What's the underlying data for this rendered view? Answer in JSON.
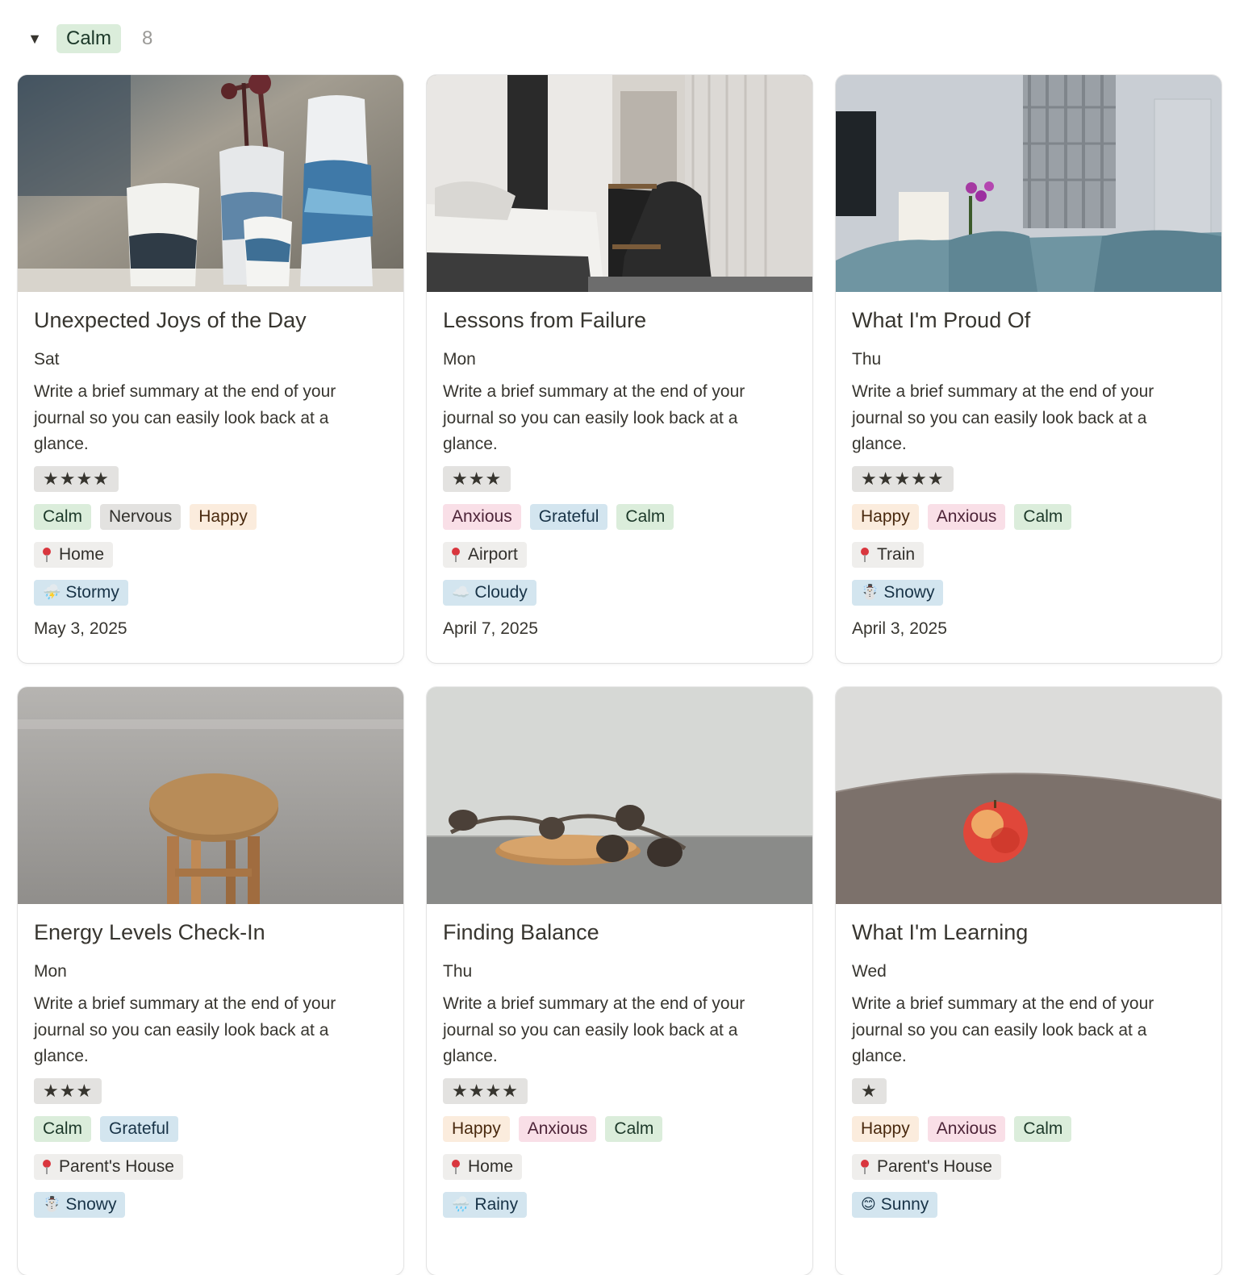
{
  "group": {
    "toggle_icon": "triangle-down-icon",
    "label": "Calm",
    "count": "8"
  },
  "cards": [
    {
      "title": "Unexpected Joys of the Day",
      "day": "Sat",
      "summary": "Write a brief summary at the end of your journal so you can easily look back at a glance.",
      "rating": "★★★★",
      "feelings": [
        {
          "label": "Calm",
          "color": "#dbeddb"
        },
        {
          "label": "Nervous",
          "color": "#e3e2e0"
        },
        {
          "label": "Happy",
          "color": "#fbecdd"
        }
      ],
      "location": "Home",
      "weather_icon": "⛈️",
      "weather": "Stormy",
      "date": "May 3, 2025",
      "cover": "vases"
    },
    {
      "title": "Lessons from Failure",
      "day": "Mon",
      "summary": "Write a brief summary at the end of your journal so you can easily look back at a glance.",
      "rating": "★★★",
      "feelings": [
        {
          "label": "Anxious",
          "color": "#f9dfe7"
        },
        {
          "label": "Grateful",
          "color": "#d3e5ef"
        },
        {
          "label": "Calm",
          "color": "#dbeddb"
        }
      ],
      "location": "Airport",
      "weather_icon": "☁️",
      "weather": "Cloudy",
      "date": "April 7, 2025",
      "cover": "bedroom"
    },
    {
      "title": "What I'm Proud Of",
      "day": "Thu",
      "summary": "Write a brief summary at the end of your journal so you can easily look back at a glance.",
      "rating": "★★★★★",
      "feelings": [
        {
          "label": "Happy",
          "color": "#fbecdd"
        },
        {
          "label": "Anxious",
          "color": "#f9dfe7"
        },
        {
          "label": "Calm",
          "color": "#dbeddb"
        }
      ],
      "location": "Train",
      "weather_icon": "☃️",
      "weather": "Snowy",
      "date": "April 3, 2025",
      "cover": "livingroom"
    },
    {
      "title": "Energy Levels Check-In",
      "day": "Mon",
      "summary": "Write a brief summary at the end of your journal so you can easily look back at a glance.",
      "rating": "★★★",
      "feelings": [
        {
          "label": "Calm",
          "color": "#dbeddb"
        },
        {
          "label": "Grateful",
          "color": "#d3e5ef"
        }
      ],
      "location": "Parent's House",
      "weather_icon": "☃️",
      "weather": "Snowy",
      "date": "",
      "cover": "stool"
    },
    {
      "title": "Finding Balance",
      "day": "Thu",
      "summary": "Write a brief summary at the end of your journal so you can easily look back at a glance.",
      "rating": "★★★★",
      "feelings": [
        {
          "label": "Happy",
          "color": "#fbecdd"
        },
        {
          "label": "Anxious",
          "color": "#f9dfe7"
        },
        {
          "label": "Calm",
          "color": "#dbeddb"
        }
      ],
      "location": "Home",
      "weather_icon": "🌧️",
      "weather": "Rainy",
      "date": "",
      "cover": "pinecones"
    },
    {
      "title": "What I'm Learning",
      "day": "Wed",
      "summary": "Write a brief summary at the end of your journal so you can easily look back at a glance.",
      "rating": "★",
      "feelings": [
        {
          "label": "Happy",
          "color": "#fbecdd"
        },
        {
          "label": "Anxious",
          "color": "#f9dfe7"
        },
        {
          "label": "Calm",
          "color": "#dbeddb"
        }
      ],
      "location": "Parent's House",
      "weather_icon": "😊",
      "weather": "Sunny",
      "date": "",
      "cover": "apple"
    }
  ]
}
